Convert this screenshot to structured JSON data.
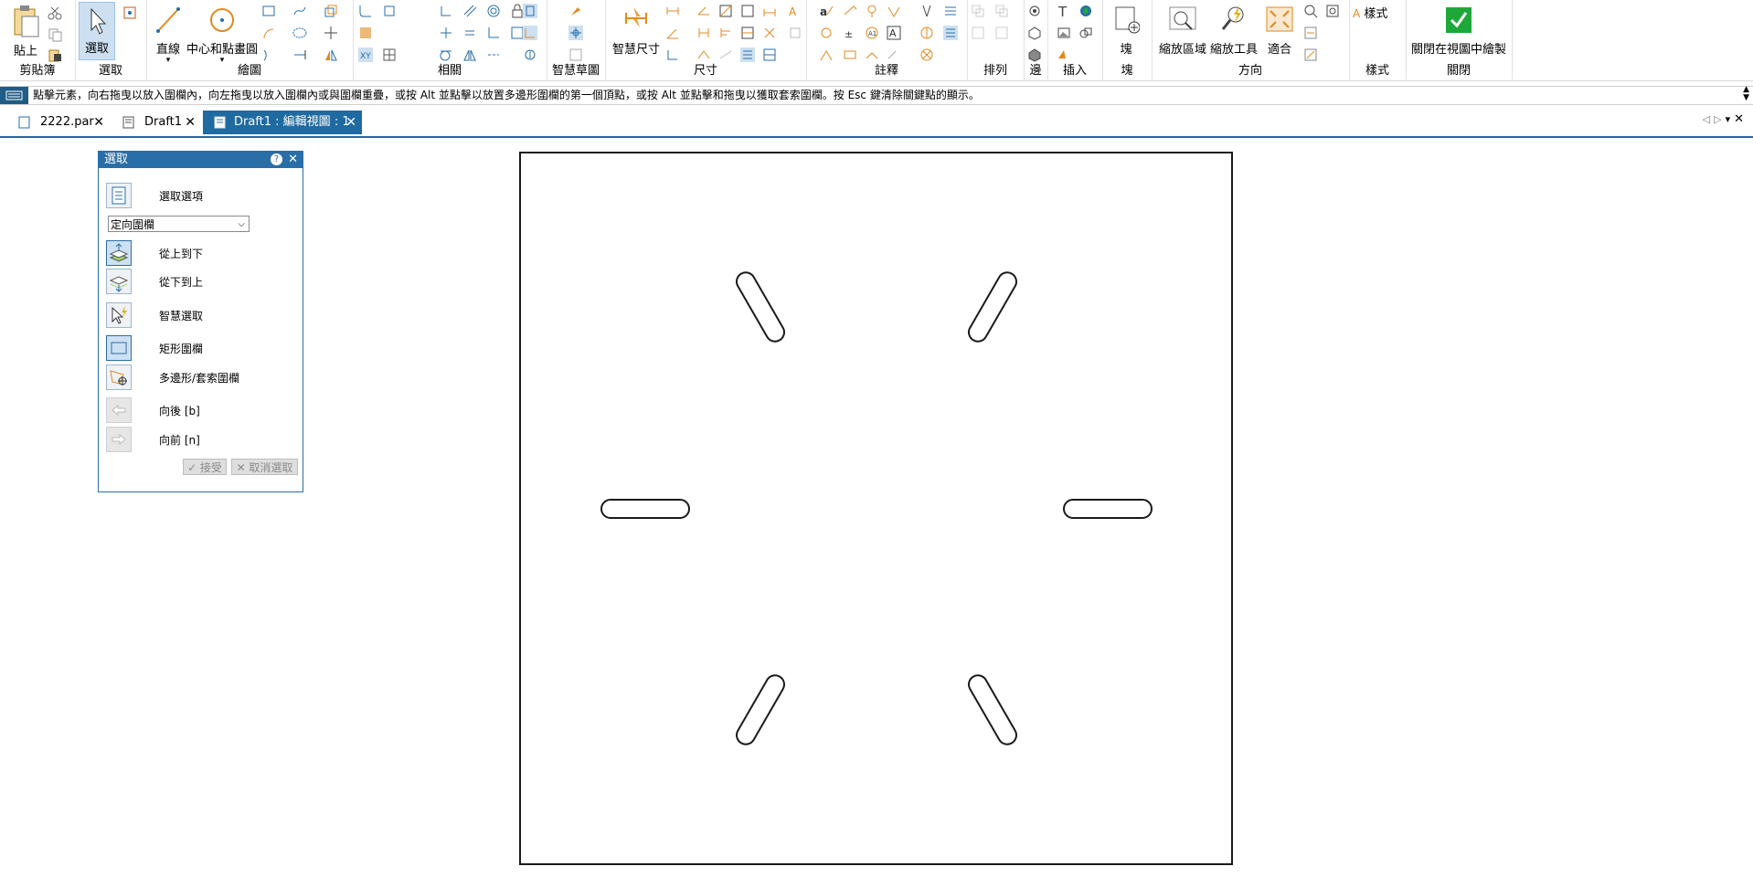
{
  "ribbon": {
    "clipboard": {
      "paste_label": "貼上",
      "group_label": "剪貼簿"
    },
    "select": {
      "select_label": "選取",
      "group_label": "選取"
    },
    "draw": {
      "line_label": "直線",
      "circle_label": "中心和點畫圓",
      "group_label": "繪圖"
    },
    "relate": {
      "group_label": "相關"
    },
    "sketch": {
      "group_label": "智慧草圖"
    },
    "dimension": {
      "smart_dim_label": "智慧尺寸",
      "group_label": "尺寸"
    },
    "annotation": {
      "group_label": "註釋"
    },
    "arrange": {
      "group_label": "排列"
    },
    "edge": {
      "group_label": "邊"
    },
    "insert": {
      "group_label": "插入"
    },
    "block": {
      "block_label": "塊",
      "group_label": "塊"
    },
    "orient": {
      "zoom_area_label": "縮放區域",
      "zoom_tool_label": "縮放工具",
      "fit_label": "適合",
      "group_label": "方向"
    },
    "style": {
      "style_label": "樣式",
      "group_label": "樣式"
    },
    "close": {
      "close_label": "關閉在視圖中繪製",
      "group_label": "關閉"
    }
  },
  "status": {
    "message": "點擊元素，向右拖曳以放入圍欄內，向左拖曳以放入圍欄內或與圍欄重疊，或按 Alt 並點擊以放置多邊形圍欄的第一個頂點，或按 Alt 並點擊和拖曳以獲取套索圍欄。按 Esc 鍵清除關鍵點的顯示。"
  },
  "tabs": [
    {
      "label": "2222.par",
      "close": "✕"
    },
    {
      "label": "Draft1",
      "close": "✕"
    },
    {
      "label": "Draft1 : 編輯視圖 : 1",
      "close": "✕"
    }
  ],
  "select_panel": {
    "title": "選取",
    "help": "?",
    "close": "✕",
    "options_label": "選取選項",
    "fence_mode": "定向圍欄",
    "top_down": "從上到下",
    "bottom_up": "從下到上",
    "smart_select": "智慧選取",
    "rect_fence": "矩形圍欄",
    "polygon_fence": "多邊形/套索圍欄",
    "back": "向後 [b]",
    "forward": "向前 [n]",
    "accept": "✓ 接受",
    "deselect": "✕ 取消選取"
  },
  "colors": {
    "accent": "#1f6aa0",
    "panel_title": "#2a6ea8",
    "close_check": "#1fa83a",
    "orange_icon": "#e08a1e"
  }
}
